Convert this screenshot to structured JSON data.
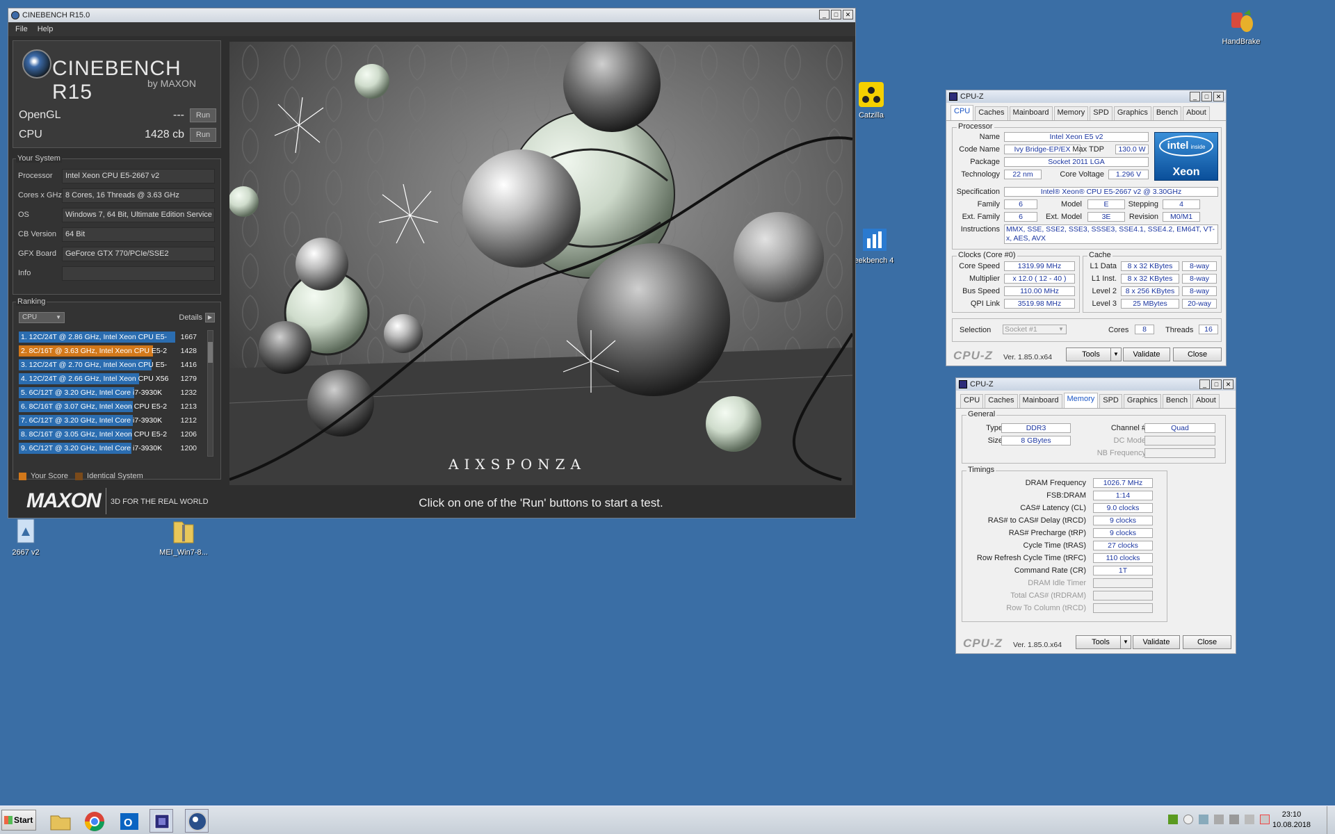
{
  "desktop": {
    "icons": [
      {
        "label": "HandBrake"
      },
      {
        "label": "Catzilla"
      },
      {
        "label": "eekbench 4"
      },
      {
        "label": "2667 v2"
      },
      {
        "label": "MEI_Win7-8..."
      }
    ]
  },
  "cinebench": {
    "title": "CINEBENCH R15.0",
    "menu": [
      "File",
      "Help"
    ],
    "brand": "CINEBENCH R15",
    "by": "by MAXON",
    "opengl_label": "OpenGL",
    "opengl_value": "---",
    "cpu_label": "CPU",
    "cpu_value": "1428 cb",
    "run_label": "Run",
    "system_title": "Your System",
    "system": [
      {
        "key": "Processor",
        "value": "Intel Xeon CPU E5-2667 v2"
      },
      {
        "key": "Cores x GHz",
        "value": "8 Cores, 16 Threads @ 3.63 GHz"
      },
      {
        "key": "OS",
        "value": "Windows 7, 64 Bit, Ultimate Edition Service"
      },
      {
        "key": "CB Version",
        "value": "64 Bit"
      },
      {
        "key": "GFX Board",
        "value": "GeForce GTX 770/PCIe/SSE2"
      },
      {
        "key": "Info",
        "value": ""
      }
    ],
    "ranking_title": "Ranking",
    "ranking_select": "CPU",
    "details_label": "Details",
    "ranking": [
      {
        "text": "1. 12C/24T @ 2.86 GHz,  Intel Xeon CPU E5-",
        "score": "1667",
        "fill": 1.0,
        "highlight": false
      },
      {
        "text": "2. 8C/16T @ 3.63 GHz,  Intel Xeon CPU E5-2",
        "score": "1428",
        "fill": 0.857,
        "highlight": true
      },
      {
        "text": "3. 12C/24T @ 2.70 GHz,  Intel Xeon CPU E5-",
        "score": "1416",
        "fill": 0.849,
        "highlight": false
      },
      {
        "text": "4. 12C/24T @ 2.66 GHz, Intel Xeon CPU X56",
        "score": "1279",
        "fill": 0.767,
        "highlight": false
      },
      {
        "text": "5. 6C/12T @ 3.20 GHz,  Intel Core i7-3930K",
        "score": "1232",
        "fill": 0.739,
        "highlight": false
      },
      {
        "text": "6. 8C/16T @ 3.07 GHz,  Intel Xeon CPU E5-2",
        "score": "1213",
        "fill": 0.728,
        "highlight": false
      },
      {
        "text": "7. 6C/12T @ 3.20 GHz,  Intel Core i7-3930K",
        "score": "1212",
        "fill": 0.727,
        "highlight": false
      },
      {
        "text": "8. 8C/16T @ 3.05 GHz,  Intel Xeon CPU E5-2",
        "score": "1206",
        "fill": 0.723,
        "highlight": false
      },
      {
        "text": "9. 6C/12T @ 3.20 GHz,  Intel Core i7-3930K",
        "score": "1200",
        "fill": 0.72,
        "highlight": false
      }
    ],
    "legend_your": "Your Score",
    "legend_identical": "Identical System",
    "footer_logo": "MAXON",
    "footer_tagline": "3D FOR THE REAL WORLD",
    "render_watermark": "AIXSPONZA",
    "status": "Click on one of the 'Run' buttons to start a test.",
    "colors": {
      "highlight": "#d2781a",
      "bar": "#2b6db0",
      "identical": "#7a4a1a"
    }
  },
  "cpuz1": {
    "title": "CPU-Z",
    "tabs": [
      "CPU",
      "Caches",
      "Mainboard",
      "Memory",
      "SPD",
      "Graphics",
      "Bench",
      "About"
    ],
    "processor_group": "Processor",
    "name_label": "Name",
    "name": "Intel Xeon E5 v2",
    "codename_label": "Code Name",
    "codename": "Ivy Bridge-EP/EX",
    "maxtdp_label": "Max TDP",
    "maxtdp": "130.0 W",
    "package_label": "Package",
    "package": "Socket 2011 LGA",
    "technology_label": "Technology",
    "technology": "22 nm",
    "corevoltage_label": "Core Voltage",
    "corevoltage": "1.296 V",
    "spec_label": "Specification",
    "spec": "Intel® Xeon® CPU E5-2667 v2 @ 3.30GHz",
    "family_label": "Family",
    "family": "6",
    "model_label": "Model",
    "model": "E",
    "stepping_label": "Stepping",
    "stepping": "4",
    "extfamily_label": "Ext. Family",
    "extfamily": "6",
    "extmodel_label": "Ext. Model",
    "extmodel": "3E",
    "revision_label": "Revision",
    "revision": "M0/M1",
    "instr_label": "Instructions",
    "instr": "MMX, SSE, SSE2, SSE3, SSSE3, SSE4.1, SSE4.2, EM64T, VT-x, AES, AVX",
    "badge_inside": "intel inside",
    "badge_intel": "intel",
    "badge_xeon": "Xeon",
    "clocks_group": "Clocks (Core #0)",
    "corespeed_label": "Core Speed",
    "corespeed": "1319.99 MHz",
    "multiplier_label": "Multiplier",
    "multiplier": "x 12.0 ( 12 - 40 )",
    "busspeed_label": "Bus Speed",
    "busspeed": "110.00 MHz",
    "qpi_label": "QPI Link",
    "qpi": "3519.98 MHz",
    "cache_group": "Cache",
    "l1d_label": "L1 Data",
    "l1d": "8 x 32 KBytes",
    "l1d_way": "8-way",
    "l1i_label": "L1 Inst.",
    "l1i": "8 x 32 KBytes",
    "l1i_way": "8-way",
    "l2_label": "Level 2",
    "l2": "8 x 256 KBytes",
    "l2_way": "8-way",
    "l3_label": "Level 3",
    "l3": "25 MBytes",
    "l3_way": "20-way",
    "selection_label": "Selection",
    "selection": "Socket #1",
    "cores_label": "Cores",
    "cores": "8",
    "threads_label": "Threads",
    "threads": "16",
    "brand": "CPU-Z",
    "version": "Ver. 1.85.0.x64",
    "tools": "Tools",
    "validate": "Validate",
    "close": "Close"
  },
  "cpuz2": {
    "title": "CPU-Z",
    "tabs": [
      "CPU",
      "Caches",
      "Mainboard",
      "Memory",
      "SPD",
      "Graphics",
      "Bench",
      "About"
    ],
    "general_group": "General",
    "type_label": "Type",
    "type": "DDR3",
    "size_label": "Size",
    "size": "8 GBytes",
    "channel_label": "Channel #",
    "channel": "Quad",
    "dcmode_label": "DC Mode",
    "nbfreq_label": "NB Frequency",
    "timings_group": "Timings",
    "dramfreq_label": "DRAM Frequency",
    "dramfreq": "1026.7 MHz",
    "fsbdram_label": "FSB:DRAM",
    "fsbdram": "1:14",
    "cl_label": "CAS# Latency (CL)",
    "cl": "9.0 clocks",
    "trcd_label": "RAS# to CAS# Delay (tRCD)",
    "trcd": "9 clocks",
    "trp_label": "RAS# Precharge (tRP)",
    "trp": "9 clocks",
    "tras_label": "Cycle Time (tRAS)",
    "tras": "27 clocks",
    "trfc_label": "Row Refresh Cycle Time (tRFC)",
    "trfc": "110 clocks",
    "cr_label": "Command Rate (CR)",
    "cr": "1T",
    "idle_label": "DRAM Idle Timer",
    "trdram_label": "Total CAS# (tRDRAM)",
    "trcd2_label": "Row To Column (tRCD)",
    "brand": "CPU-Z",
    "version": "Ver. 1.85.0.x64",
    "tools": "Tools",
    "validate": "Validate",
    "close": "Close"
  },
  "taskbar": {
    "start": "Start",
    "time": "23:10",
    "date": "10.08.2018"
  }
}
